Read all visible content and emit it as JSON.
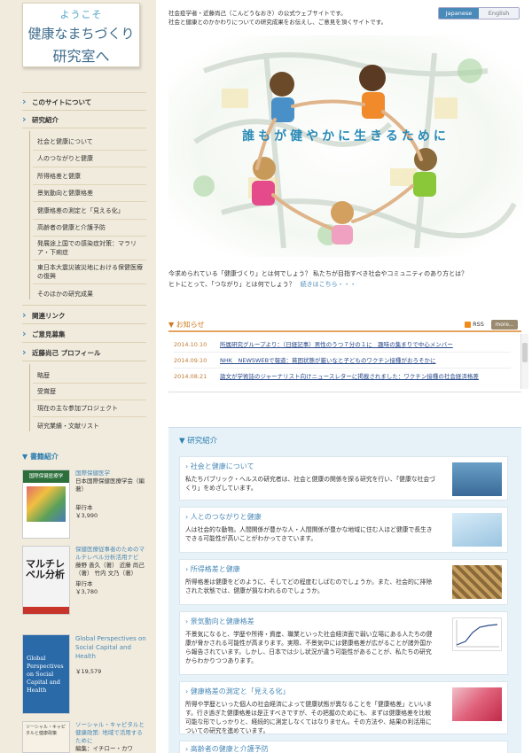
{
  "logo": {
    "top": "ようこそ",
    "mid": "健康なまちづくり",
    "bot": "研究室へ"
  },
  "nav": [
    {
      "label": "このサイトについて"
    },
    {
      "label": "研究紹介",
      "subs": [
        "社会と健康について",
        "人のつながりと健康",
        "所得格差と健康",
        "景気動向と健康格差",
        "健康格差の測定と「見える化」",
        "高齢者の健康と介護予防",
        "発展途上国での感染症対策：マラリア・下痢症",
        "東日本大震災被災地における保健医療の復興",
        "そのほかの研究成果"
      ]
    },
    {
      "label": "関連リンク"
    },
    {
      "label": "ご意見募集"
    },
    {
      "label": "近藤尚己 プロフィール",
      "subs": [
        "略歴",
        "受賞歴",
        "現在の主な参加プロジェクト",
        "研究業績・文献リスト"
      ]
    }
  ],
  "books": {
    "heading": "書籍紹介",
    "items": [
      {
        "cover": "国際保健医療学",
        "title": "国際保健医学",
        "desc": "日本国際保健医療学会（編著）",
        "format": "単行本",
        "price": "￥3,990"
      },
      {
        "cover": "マルチレベル分析",
        "title": "保健医療従事者のためのマルチレベル分析活用ナビ",
        "desc": "藤野 善久（著） 近藤 尚己（著） 竹内 文乃（著）",
        "format": "単行本",
        "price": "￥3,780"
      },
      {
        "cover": "Global Perspectives on Social Capital and Health",
        "title": "Global Perspectives on Social Capital and Health",
        "desc": "",
        "format": "",
        "price": "￥19,579"
      },
      {
        "cover": "ソーシャル・キャピタルと健康政策",
        "title": "ソーシャル・キャピタルと健康政策: 地域で活用するために",
        "desc": "編集：イチロー・カワ",
        "format": "",
        "price": ""
      }
    ]
  },
  "header": {
    "intro1": "社会疫学者・近藤尚己（こんどうなおき）の公式ウェブサイトです。",
    "intro2": "社会と健康とのかかわりについての研究成果をお伝えし、ご意見を頂くサイトです。",
    "lang_jp": "Japanese",
    "lang_en": "English"
  },
  "hero": {
    "caption": "誰もが健やかに生きるために"
  },
  "tagline": {
    "line1": "今求められている「健康づくり」とは何でしょう？ 私たちが目指すべき社会やコミュニティのあり方とは？",
    "line2": "ヒトにとって、「つながり」とは何でしょう？",
    "more": "続きはこちら・・・"
  },
  "news": {
    "heading": "お知らせ",
    "rss": "RSS",
    "more": "more...",
    "items": [
      {
        "date": "2014.10.10",
        "title": "所属研究グループより：（日経記事）男性のうつ７分の１に　趣味の集まりで中心メンバー"
      },
      {
        "date": "2014.09.10",
        "title": "NHK　NEWSWEBで報道：貧困状態が厳いなと子どものワクチン接種がおろそかに"
      },
      {
        "date": "2014.08.21",
        "title": "論文が学術誌のジャーナリスト向けニュースレターに掲載されました：ワクチン接種の社会経済格差"
      }
    ]
  },
  "research": {
    "heading": "研究紹介",
    "items": [
      {
        "title": "社会と健康について",
        "desc": "私たちパブリック・ヘルスの研究者は、社会と健康の関係を探る研究を行い、「健康な社会づくり」をめざしています。"
      },
      {
        "title": "人とのつながりと健康",
        "desc": "人は社会的な動物。人間関係が豊かな人・人間関係が豊かな地域に住む人ほど健康で長生きできる可能性が高いことがわかってきています。"
      },
      {
        "title": "所得格差と健康",
        "desc": "所得格差は健康をどのように、そしてどの程度むしばむのでしょうか。また、社会的に排除された状態では、健康が損なわれるのでしょうか。"
      },
      {
        "title": "景気動向と健康格差",
        "desc": "不景気になると、学歴や所得・資産、職業といった社会経済面で弱い立場にある人たちの健康が脅かされる可能性が高まります。実際、不景気中には健康格差が広がることが諸外国から報告されています。しかし、日本では少し状況が違う可能性があることが、私たちの研究からわかりつつあります。"
      },
      {
        "title": "健康格差の測定と「見える化」",
        "desc": "所得や学歴といった個人の社会経済によって健康状態が異なることを「健康格差」といいます。行き過ぎた健康格差は是正すべきですが、その把握のためにも、まずは健康格差を比較可能な形でしっかりと、経続的に測定しなくてはなりません。その方法や、結果の利活用についての研究を進めています。"
      },
      {
        "title": "高齢者の健康と介護予防",
        "desc": ""
      }
    ]
  }
}
